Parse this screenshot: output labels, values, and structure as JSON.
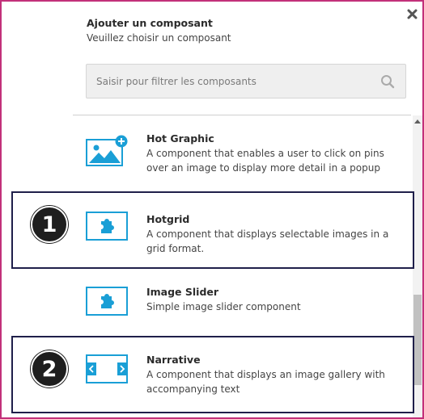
{
  "dialog": {
    "title": "Ajouter un composant",
    "subtitle": "Veuillez choisir un composant",
    "close_icon": "close-icon"
  },
  "search": {
    "placeholder": "Saisir pour filtrer les composants",
    "value": "",
    "icon": "search-icon"
  },
  "components": [
    {
      "name": "Hot Graphic",
      "description": "A component that enables a user to click on pins over an image to display more detail in a popup",
      "icon": "image-add-icon"
    },
    {
      "name": "Hotgrid",
      "description": "A component that displays selectable images in a grid format.",
      "icon": "puzzle-piece-icon"
    },
    {
      "name": "Image Slider",
      "description": "Simple image slider component",
      "icon": "puzzle-piece-icon"
    },
    {
      "name": "Narrative",
      "description": "A component that displays an image gallery with accompanying text",
      "icon": "slider-arrows-icon"
    }
  ],
  "annotations": [
    {
      "label": "1"
    },
    {
      "label": "2"
    }
  ],
  "colors": {
    "accent": "#1a9fd6",
    "frame_border": "#c2307a",
    "highlight_border": "#1f1f4a",
    "badge_bg": "#1e1e1e"
  }
}
